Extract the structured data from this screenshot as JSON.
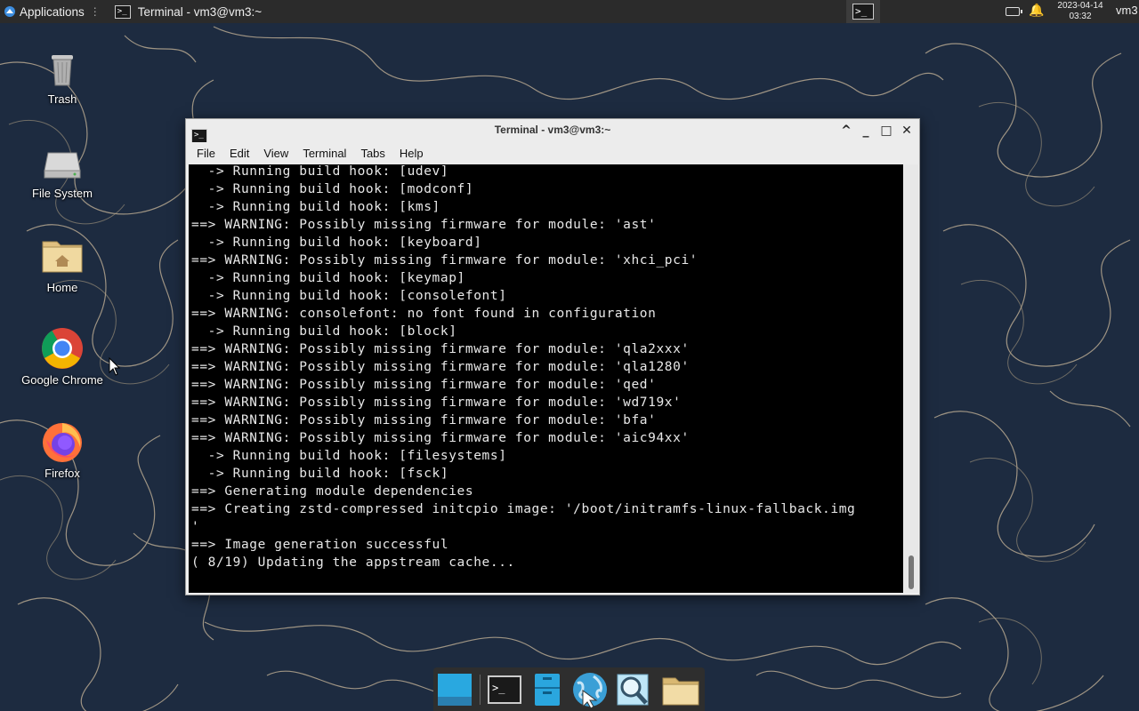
{
  "top_panel": {
    "applications_label": "Applications",
    "task_title": "Terminal - vm3@vm3:~",
    "clock_date": "2023-04-14",
    "clock_time": "03:32",
    "user": "vm3"
  },
  "desktop_icons": [
    {
      "label": "Trash",
      "icon": "trash-icon"
    },
    {
      "label": "File System",
      "icon": "drive-icon"
    },
    {
      "label": "Home",
      "icon": "home-folder-icon"
    },
    {
      "label": "Google Chrome",
      "icon": "chrome-icon"
    },
    {
      "label": "Firefox",
      "icon": "firefox-icon"
    }
  ],
  "window": {
    "title": "Terminal - vm3@vm3:~",
    "menu": [
      "File",
      "Edit",
      "View",
      "Terminal",
      "Tabs",
      "Help"
    ],
    "lines": [
      "  -> Running build hook: [udev]",
      "  -> Running build hook: [modconf]",
      "  -> Running build hook: [kms]",
      "==> WARNING: Possibly missing firmware for module: 'ast'",
      "  -> Running build hook: [keyboard]",
      "==> WARNING: Possibly missing firmware for module: 'xhci_pci'",
      "  -> Running build hook: [keymap]",
      "  -> Running build hook: [consolefont]",
      "==> WARNING: consolefont: no font found in configuration",
      "  -> Running build hook: [block]",
      "==> WARNING: Possibly missing firmware for module: 'qla2xxx'",
      "==> WARNING: Possibly missing firmware for module: 'qla1280'",
      "==> WARNING: Possibly missing firmware for module: 'qed'",
      "==> WARNING: Possibly missing firmware for module: 'wd719x'",
      "==> WARNING: Possibly missing firmware for module: 'bfa'",
      "==> WARNING: Possibly missing firmware for module: 'aic94xx'",
      "  -> Running build hook: [filesystems]",
      "  -> Running build hook: [fsck]",
      "==> Generating module dependencies",
      "==> Creating zstd-compressed initcpio image: '/boot/initramfs-linux-fallback.img",
      "'",
      "==> Image generation successful",
      "( 8/19) Updating the appstream cache..."
    ]
  },
  "dock": [
    {
      "icon": "show-desktop-icon"
    },
    {
      "icon": "terminal-icon"
    },
    {
      "icon": "file-manager-icon"
    },
    {
      "icon": "web-browser-icon"
    },
    {
      "icon": "app-finder-icon"
    },
    {
      "icon": "folder-icon"
    }
  ]
}
